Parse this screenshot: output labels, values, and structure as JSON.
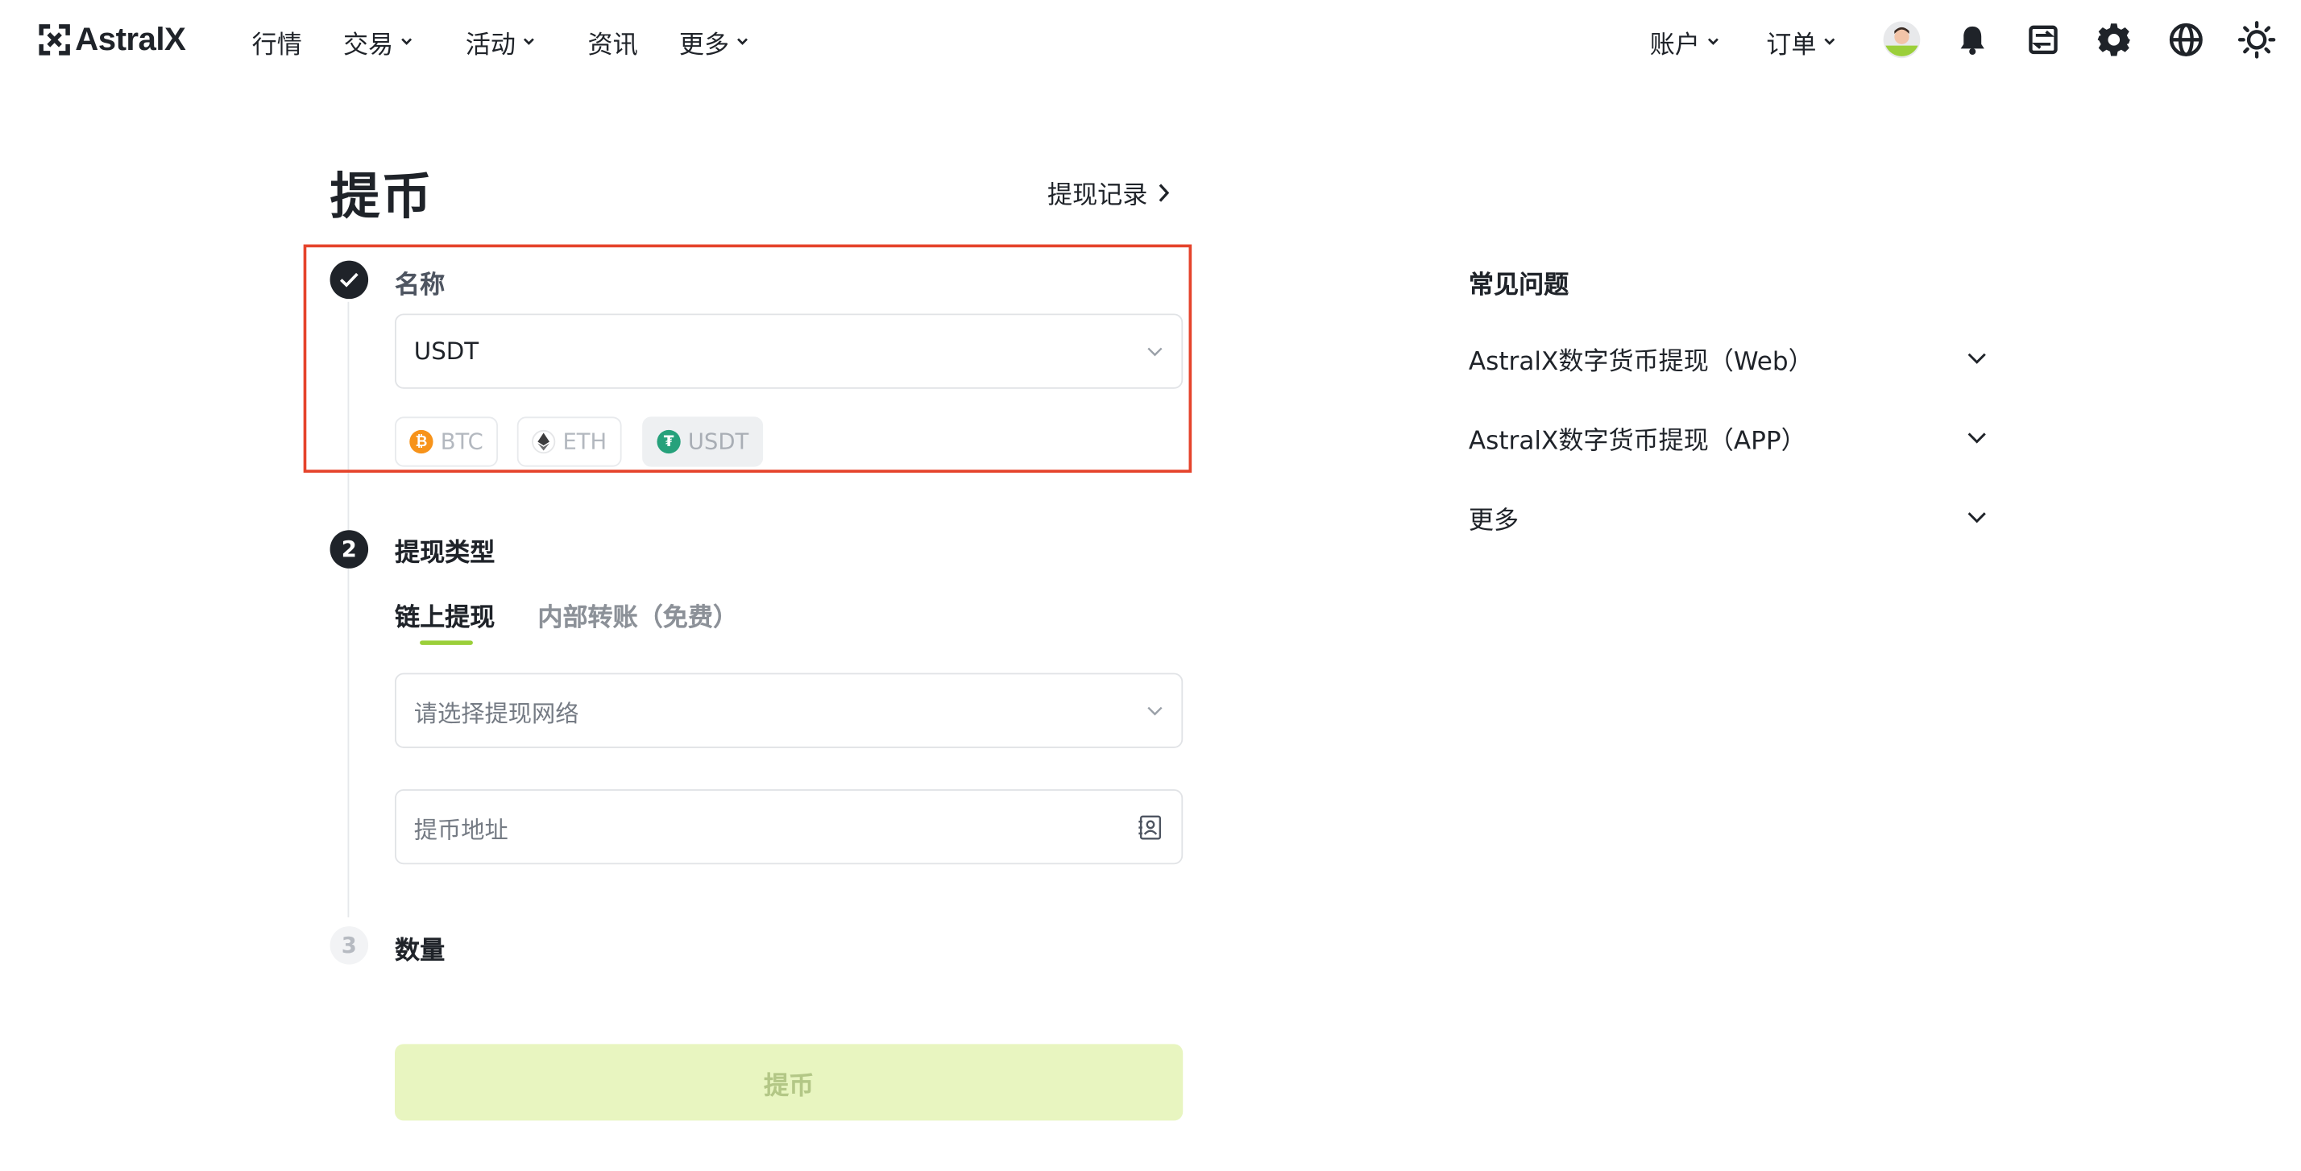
{
  "header": {
    "logo_text": "AstralX",
    "nav": [
      {
        "label": "行情",
        "has_dropdown": false
      },
      {
        "label": "交易",
        "has_dropdown": true
      },
      {
        "label": "活动",
        "has_dropdown": true
      },
      {
        "label": "资讯",
        "has_dropdown": false
      },
      {
        "label": "更多",
        "has_dropdown": true
      }
    ],
    "right_nav": [
      {
        "label": "账户",
        "has_dropdown": true
      },
      {
        "label": "订单",
        "has_dropdown": true
      }
    ],
    "icons": [
      "avatar",
      "bell-icon",
      "transfer-icon",
      "gear-icon",
      "globe-icon",
      "sun-icon"
    ]
  },
  "page": {
    "title": "提币",
    "record_link": "提现记录"
  },
  "steps": {
    "coin": {
      "number": "1",
      "label": "名称",
      "selected_value": "USDT",
      "quick_coins": [
        {
          "symbol": "BTC",
          "color": "#f7931a",
          "glyph": "₿"
        },
        {
          "symbol": "ETH",
          "color": "#3c3c3d",
          "glyph": "◆"
        },
        {
          "symbol": "USDT",
          "color": "#26a17b",
          "glyph": "₮"
        }
      ]
    },
    "type": {
      "number": "2",
      "label": "提现类型",
      "tabs": [
        "链上提现",
        "内部转账（免费）"
      ],
      "network_placeholder": "请选择提现网络",
      "address_placeholder": "提币地址"
    },
    "amount": {
      "number": "3",
      "label": "数量"
    }
  },
  "submit_label": "提币",
  "faq": {
    "title": "常见问题",
    "items": [
      "AstralX数字货币提现（Web）",
      "AstralX数字货币提现（APP）",
      "更多"
    ]
  },
  "colors": {
    "accent": "#9bcf3a",
    "highlight_border": "#e5432b",
    "submit_bg": "#e8f5c0"
  }
}
